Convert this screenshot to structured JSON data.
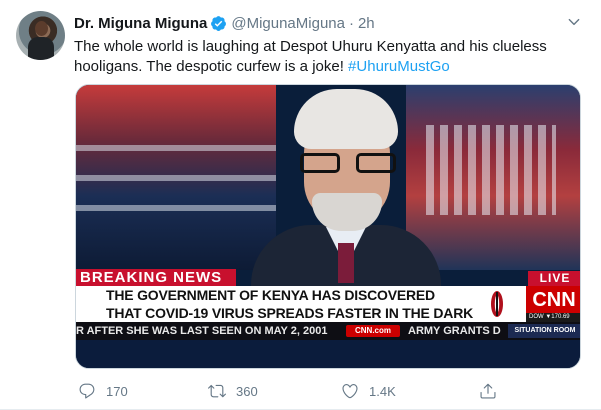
{
  "tweet": {
    "author_name": "Dr. Miguna Miguna",
    "handle": "@MigunaMiguna",
    "separator": "·",
    "time": "2h",
    "text_main": "The whole world is laughing at Despot Uhuru Kenyatta and his clueless hooligans. The despotic curfew is a joke! ",
    "hashtag": "#UhuruMustGo"
  },
  "media": {
    "breaking_label": "BREAKING NEWS",
    "live_label": "LIVE",
    "headline_line1": "THE GOVERNMENT OF KENYA HAS DISCOVERED",
    "headline_line2": "THAT COVID-19 VIRUS SPREADS FASTER IN THE DARK",
    "network_logo": "CNN",
    "dow_label": "DOW  ▼170.69",
    "ticker_left": "R AFTER SHE WAS LAST SEEN ON MAY 2, 2001",
    "ticker_pill": "CNN.com",
    "ticker_right": "ARMY GRANTS D",
    "situation_label": "SITUATION ROOM"
  },
  "actions": {
    "reply_count": "170",
    "retweet_count": "360",
    "like_count": "1.4K"
  },
  "colors": {
    "accent": "#1da1f2",
    "muted": "#657786",
    "breaking_red": "#c8102e"
  },
  "icons": [
    "verified-badge-icon",
    "caret-down-icon",
    "reply-icon",
    "retweet-icon",
    "like-icon",
    "share-icon"
  ]
}
